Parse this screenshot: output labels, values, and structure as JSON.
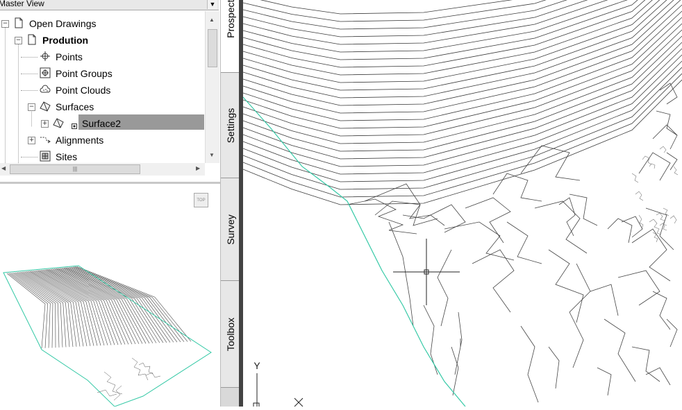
{
  "panel": {
    "view_selector": "Master View",
    "tree": [
      {
        "label": "Open Drawings",
        "icon": "drawings-icon",
        "expander": "−"
      },
      {
        "label": "Prodution",
        "icon": "drawing-icon",
        "expander": "−"
      },
      {
        "label": "Points",
        "icon": "points-icon"
      },
      {
        "label": "Point Groups",
        "icon": "point-groups-icon"
      },
      {
        "label": "Point Clouds",
        "icon": "point-clouds-icon"
      },
      {
        "label": "Surfaces",
        "icon": "surfaces-icon",
        "expander": "−"
      },
      {
        "label": "Surface2",
        "icon": "surface-icon",
        "expander": "+",
        "selected": true
      },
      {
        "label": "Alignments",
        "icon": "alignments-icon",
        "expander": "+"
      },
      {
        "label": "Sites",
        "icon": "sites-icon"
      }
    ],
    "preview_button": "TOP"
  },
  "side_tabs": [
    "Prospector",
    "Settings",
    "Survey",
    "Toolbox"
  ],
  "ucs": {
    "y_label": "Y",
    "x_label": "X"
  },
  "colors": {
    "boundary": "#35c9a6",
    "contour": "#3a3a3a",
    "separator": "#434343"
  }
}
